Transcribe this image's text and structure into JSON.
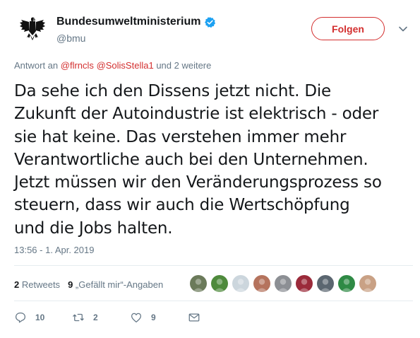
{
  "author": {
    "display_name": "Bundesumweltministerium",
    "handle": "@bmu",
    "verified": true
  },
  "follow_button": {
    "label": "Folgen"
  },
  "reply_context": {
    "prefix": "Antwort an",
    "mentions": [
      "@flrncls",
      "@SolisStella1"
    ],
    "suffix": "und 2 weitere"
  },
  "tweet": {
    "text": "Da sehe ich den Dissens jetzt nicht. Die\nZukunft der Autoindustrie ist elektrisch - oder\nsie hat keine. Das verstehen immer mehr\nVerantwortliche auch bei den Unternehmen.\nJetzt müssen wir den Veränderungsprozess so\nsteuern, dass wir auch die Wertschöpfung\nund die Jobs halten.",
    "timestamp": "13:56 - 1. Apr. 2019"
  },
  "stats": {
    "retweets_count": "2",
    "retweets_label": "Retweets",
    "likes_count": "9",
    "likes_label": "„Gefällt mir“-Angaben"
  },
  "likers": [
    {
      "name": "liker-1",
      "color": "#6b7a5a"
    },
    {
      "name": "liker-2",
      "color": "#4e8a3c"
    },
    {
      "name": "liker-3",
      "color": "#ccd6dd"
    },
    {
      "name": "liker-4",
      "color": "#b5735d"
    },
    {
      "name": "liker-5",
      "color": "#8c8f94"
    },
    {
      "name": "liker-6",
      "color": "#9b2a3a"
    },
    {
      "name": "liker-7",
      "color": "#5b6670"
    },
    {
      "name": "liker-8",
      "color": "#2f8a45"
    },
    {
      "name": "liker-9",
      "color": "#c9a185"
    }
  ],
  "actions": {
    "reply_count": "10",
    "retweet_count": "2",
    "like_count": "9"
  },
  "colors": {
    "accent": "#d32f2f",
    "verified": "#1da1f2",
    "secondary_text": "#657786"
  }
}
